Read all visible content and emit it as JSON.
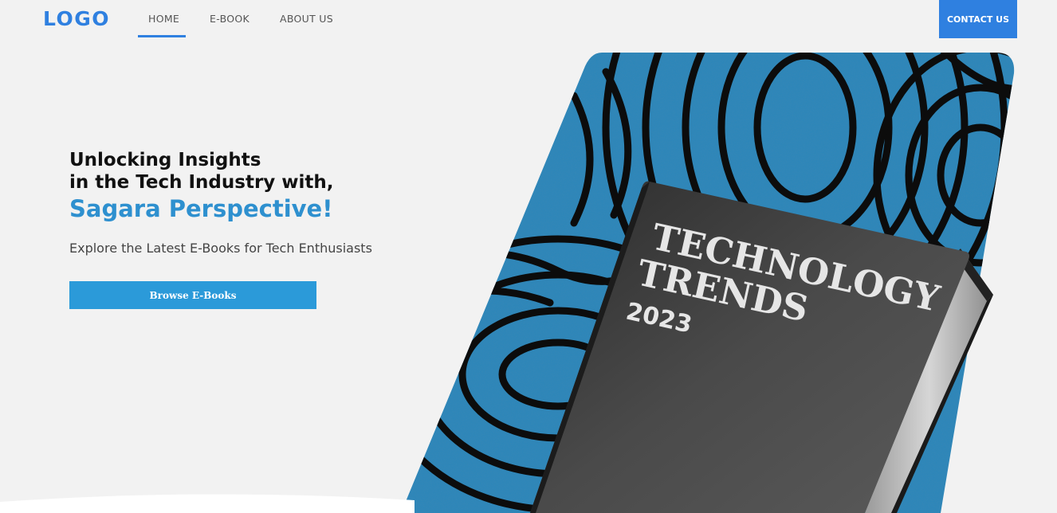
{
  "header": {
    "logo": "LOGO",
    "nav": [
      {
        "label": "HOME",
        "active": true
      },
      {
        "label": "E-BOOK",
        "active": false
      },
      {
        "label": "ABOUT US",
        "active": false
      }
    ],
    "contact_label": "CONTACT US"
  },
  "hero": {
    "line1": "Unlocking Insights",
    "line2": "in the Tech Industry with,",
    "line3": "Sagara Perspective!",
    "subtitle": "Explore the Latest E-Books for Tech Enthusiasts",
    "cta_label": "Browse E-Books"
  },
  "book": {
    "title_line1": "TECHNOLOGY",
    "title_line2": "TRENDS",
    "year": "2023"
  },
  "colors": {
    "accent": "#2f80e0",
    "hero_highlight": "#2e90cf",
    "cta": "#2b9ad9",
    "pattern_blue": "#2a86bd",
    "book_cover": "#3a3a3a"
  }
}
